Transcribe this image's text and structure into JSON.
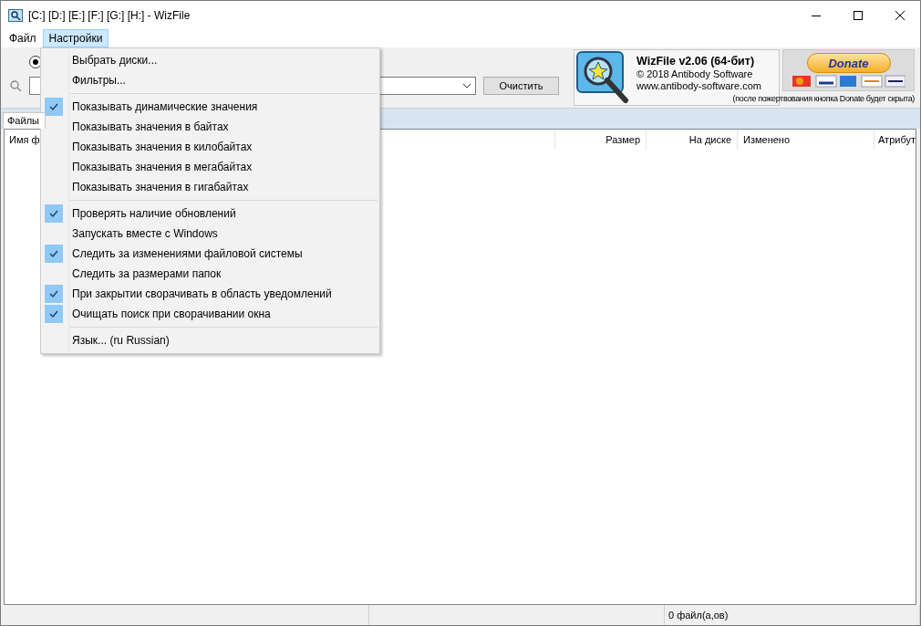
{
  "window": {
    "title": "[C:] [D:] [E:] [F:] [G:] [H:]  - WizFile"
  },
  "menubar": [
    {
      "label": "Файл",
      "selected": false
    },
    {
      "label": "Настройки",
      "selected": true
    }
  ],
  "toolbar": {
    "radio": {
      "selected": true
    },
    "clear_button": "Очистить"
  },
  "about": {
    "title": "WizFile v2.06 (64-бит)",
    "copyright": "© 2018 Antibody Software",
    "url": "www.antibody-software.com",
    "donate": "Donate",
    "donate_note": "(после пожертвования кнопка Donate будет скрыта)"
  },
  "tabs": [
    {
      "label": "Файлы",
      "selected": true
    }
  ],
  "table": {
    "columns": [
      "Имя ф",
      "Размер",
      "На диске",
      "Изменено",
      "Атрибут"
    ]
  },
  "status_bar": {
    "file_count": "0 файл(а,ов)"
  },
  "dropdown_menu": {
    "items": [
      {
        "kind": "item",
        "label": "Выбрать диски...",
        "checked": false
      },
      {
        "kind": "item",
        "label": "Фильтры...",
        "checked": false
      },
      {
        "kind": "separator"
      },
      {
        "kind": "item",
        "label": "Показывать динамические значения",
        "checked": true
      },
      {
        "kind": "item",
        "label": "Показывать значения в байтах",
        "checked": false
      },
      {
        "kind": "item",
        "label": "Показывать значения в килобайтах",
        "checked": false
      },
      {
        "kind": "item",
        "label": "Показывать значения в мегабайтах",
        "checked": false
      },
      {
        "kind": "item",
        "label": "Показывать значения в гигабайтах",
        "checked": false
      },
      {
        "kind": "separator"
      },
      {
        "kind": "item",
        "label": "Проверять наличие обновлений",
        "checked": true
      },
      {
        "kind": "item",
        "label": "Запускать вместе с Windows",
        "checked": false
      },
      {
        "kind": "item",
        "label": "Следить за изменениями файловой системы",
        "checked": true
      },
      {
        "kind": "item",
        "label": "Следить за размерами папок",
        "checked": false
      },
      {
        "kind": "item",
        "label": "При закрытии сворачивать в область уведомлений",
        "checked": true
      },
      {
        "kind": "item",
        "label": "Очищать поиск при сворачивании окна",
        "checked": true
      },
      {
        "kind": "separator"
      },
      {
        "kind": "item",
        "label": "Язык... (ru Russian)",
        "checked": false
      }
    ]
  }
}
